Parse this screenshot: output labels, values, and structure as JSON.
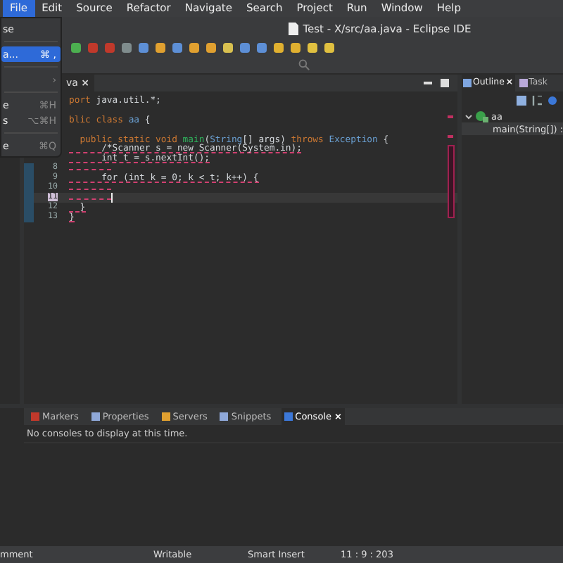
{
  "menu_bar": {
    "items": [
      {
        "label": "File",
        "selected": true
      },
      {
        "label": "Edit",
        "selected": false
      },
      {
        "label": "Source",
        "selected": false
      },
      {
        "label": "Refactor",
        "selected": false
      },
      {
        "label": "Navigate",
        "selected": false
      },
      {
        "label": "Search",
        "selected": false
      },
      {
        "label": "Project",
        "selected": false
      },
      {
        "label": "Run",
        "selected": false
      },
      {
        "label": "Window",
        "selected": false
      },
      {
        "label": "Help",
        "selected": false
      }
    ]
  },
  "window": {
    "title": "Test - X/src/aa.java - Eclipse IDE"
  },
  "dropdown": {
    "items": [
      {
        "kind": "item",
        "label": "se",
        "selected": false
      },
      {
        "kind": "separator"
      },
      {
        "kind": "item",
        "label": "a...",
        "shortcut": "⌘ ,",
        "selected": true
      },
      {
        "kind": "separator"
      },
      {
        "kind": "item",
        "arrow": "›",
        "selected": false
      },
      {
        "kind": "separator"
      },
      {
        "kind": "item",
        "label": "e",
        "shortcut": "⌘H",
        "selected": false
      },
      {
        "kind": "item",
        "label": "s",
        "shortcut": "⌥⌘H",
        "selected": false
      },
      {
        "kind": "separator"
      },
      {
        "kind": "item",
        "label": "e",
        "shortcut": "⌘Q",
        "selected": false
      }
    ]
  },
  "editor": {
    "tab": {
      "label": "va",
      "close": "×"
    },
    "lines": [
      {
        "segments": [
          {
            "kind": "keyword",
            "text": "port"
          },
          {
            "kind": "plain",
            "text": " java.util.*;"
          }
        ],
        "current": false
      },
      {
        "current": false
      },
      {
        "segments": [
          {
            "kind": "keyword",
            "text": "blic class"
          },
          {
            "kind": "type",
            "text": " aa"
          },
          {
            "kind": "plain",
            "text": " {"
          }
        ],
        "current": false
      },
      {
        "current": false
      },
      {
        "segments": [
          {
            "kind": "keyword",
            "text": "  public static void"
          },
          {
            "kind": "method",
            "text": " main"
          },
          {
            "kind": "plain",
            "text": "("
          },
          {
            "kind": "type",
            "text": "String"
          },
          {
            "kind": "plain",
            "text": "[] args) "
          },
          {
            "kind": "keyword",
            "text": "throws"
          },
          {
            "kind": "type",
            "text": " Exception"
          },
          {
            "kind": "plain",
            "text": " {"
          }
        ],
        "current": false
      },
      {
        "segments": [
          {
            "kind": "plain",
            "text": "      /*Scanner s = new Scanner(System.in);"
          }
        ],
        "marked": true,
        "current": false
      },
      {
        "segments": [
          {
            "kind": "plain",
            "text": "      int t = s.nextInt();"
          }
        ],
        "marked": true,
        "current": false
      },
      {
        "number": "8",
        "marked": true,
        "current": false
      },
      {
        "number": "9",
        "segments": [
          {
            "kind": "plain",
            "text": "      for (int k = 0; k < t; k++) {"
          }
        ],
        "marked": true,
        "current": false
      },
      {
        "number": "10",
        "marked": true,
        "current": false
      },
      {
        "number": "11",
        "marked": true,
        "current": true
      },
      {
        "number": "12",
        "segments": [
          {
            "kind": "plain",
            "text": "  }"
          }
        ],
        "marked": true,
        "current": false
      },
      {
        "number": "13",
        "segments": [
          {
            "kind": "plain",
            "text": "}"
          }
        ],
        "marked": true,
        "current": false
      }
    ]
  },
  "outline": {
    "tabs": [
      {
        "label": "Outline",
        "close": "×",
        "selected": true
      },
      {
        "label": "Task",
        "selected": false
      }
    ],
    "tree": [
      {
        "label": "aa",
        "expanded": true,
        "children": [
          {
            "label": "main(String[]) :"
          }
        ]
      }
    ]
  },
  "bottom_panel": {
    "tabs": [
      {
        "label": "Markers",
        "selected": false
      },
      {
        "label": "Properties",
        "selected": false
      },
      {
        "label": "Servers",
        "selected": false
      },
      {
        "label": "Snippets",
        "selected": false
      },
      {
        "label": "Console",
        "close": "×",
        "selected": true
      }
    ],
    "message": "No consoles to display at this time."
  },
  "status_bar": [
    "mment",
    "Writable",
    "Smart Insert",
    "11 : 9 : 203"
  ]
}
